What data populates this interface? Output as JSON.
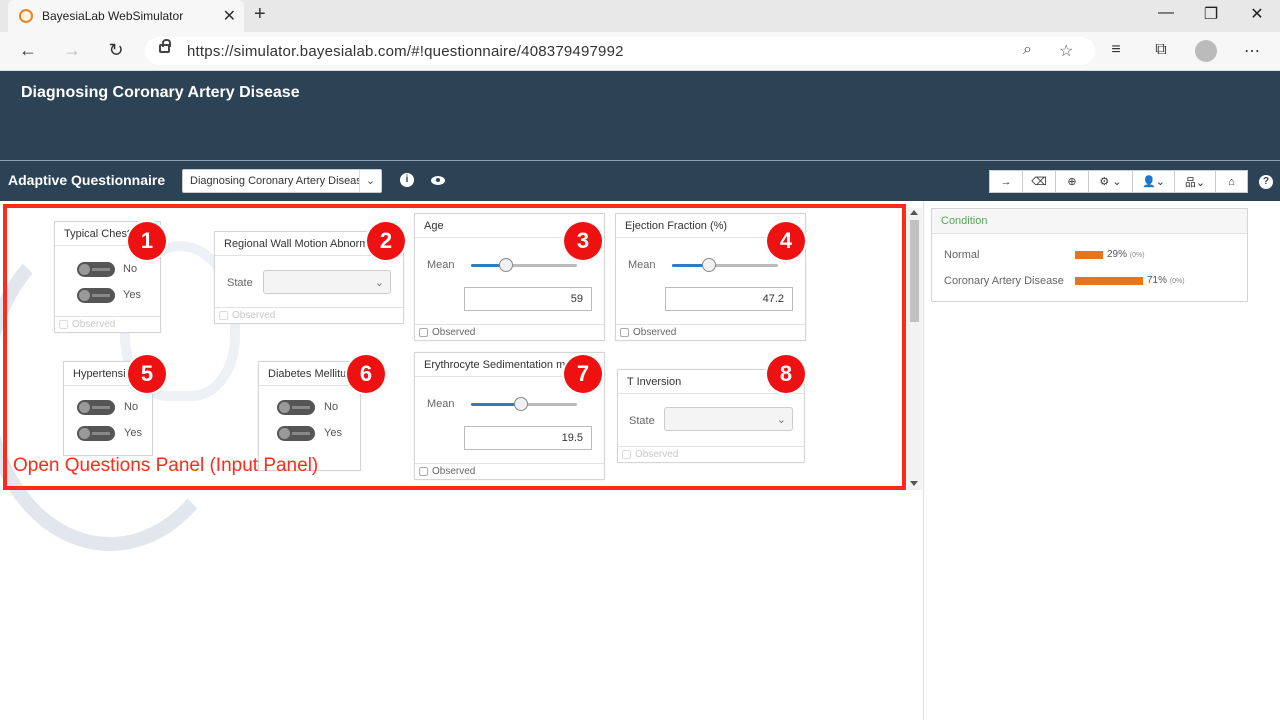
{
  "browser": {
    "tab_title": "BayesiaLab WebSimulator",
    "url": "https://simulator.bayesialab.com/#!questionnaire/408379497992"
  },
  "app": {
    "title": "Diagnosing Coronary Artery Disease",
    "toolbar_label": "Adaptive Questionnaire",
    "network_select_value": "Diagnosing Coronary Artery Disease"
  },
  "panel": {
    "caption": "Open Questions Panel (Input Panel)",
    "accent_color": "#ff2a1a"
  },
  "questions": {
    "typical_chest": {
      "title": "Typical Chest Pain",
      "opt_no": "No",
      "opt_yes": "Yes",
      "observed": "Observed",
      "badge": "1"
    },
    "regional_wall": {
      "title": "Regional Wall Motion Abnormality",
      "state_label": "State",
      "observed": "Observed",
      "badge": "2"
    },
    "age": {
      "title": "Age",
      "mean_label": "Mean",
      "value": "59",
      "slider_fraction": 0.33,
      "observed": "Observed",
      "badge": "3"
    },
    "ejection": {
      "title": "Ejection Fraction (%)",
      "mean_label": "Mean",
      "value": "47.2",
      "slider_fraction": 0.35,
      "observed": "Observed",
      "badge": "4"
    },
    "hypertension": {
      "title": "Hypertension",
      "opt_no": "No",
      "opt_yes": "Yes",
      "badge": "5"
    },
    "diabetes": {
      "title": "Diabetes Mellitus",
      "opt_no": "No",
      "opt_yes": "Yes",
      "badge": "6"
    },
    "esr": {
      "title": "Erythrocyte Sedimentation mm/h",
      "mean_label": "Mean",
      "value": "19.5",
      "slider_fraction": 0.47,
      "observed": "Observed",
      "badge": "7"
    },
    "t_inversion": {
      "title": "T Inversion",
      "state_label": "State",
      "observed": "Observed",
      "badge": "8"
    }
  },
  "condition": {
    "title": "Condition",
    "rows": [
      {
        "label": "Normal",
        "percent": "29%",
        "sub": "(0%)",
        "fraction": 0.29
      },
      {
        "label": "Coronary Artery Disease",
        "percent": "71%",
        "sub": "(0%)",
        "fraction": 0.71
      }
    ],
    "bar_color": "#e4741d",
    "title_color": "#5aa55a"
  },
  "icons": [
    "back-icon",
    "forward-icon",
    "reload-icon",
    "lock-icon",
    "zoom-icon",
    "star-icon",
    "favorites-icon",
    "collections-icon",
    "profile-icon",
    "menu-icon",
    "info-icon",
    "eye-icon",
    "arrow-right-icon",
    "eraser-icon",
    "plus-circle-icon",
    "gear-icon",
    "user-icon",
    "network-icon",
    "home-icon",
    "help-icon"
  ]
}
